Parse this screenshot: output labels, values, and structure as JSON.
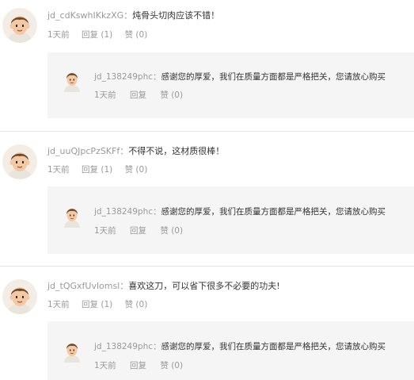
{
  "comments": [
    {
      "username": "jd_cdKswhIKkzXG",
      "separator": "：",
      "content": "炖骨头切肉应该不错！",
      "time": "1天前",
      "reply_label": "回复 (1)",
      "like_label": "赞 (0)",
      "reply": {
        "username": "jd_138249phc",
        "separator": "：",
        "content": "感谢您的厚爱，我们在质量方面都是严格把关，您请放心购买",
        "time": "1天前",
        "reply_label": "回复",
        "like_label": "赞 (0)"
      }
    },
    {
      "username": "jd_uuQJpcPzSKFf",
      "separator": "：",
      "content": "不得不说，这材质很棒！",
      "time": "1天前",
      "reply_label": "回复 (1)",
      "like_label": "赞 (0)",
      "reply": {
        "username": "jd_138249phc",
        "separator": "：",
        "content": "感谢您的厚爱，我们在质量方面都是严格把关，您请放心购买",
        "time": "1天前",
        "reply_label": "回复",
        "like_label": "赞 (0)"
      }
    },
    {
      "username": "jd_tQGxfUvlomsl",
      "separator": "：",
      "content": "喜欢这刀，可以省下很多不必要的功夫!",
      "time": "1天前",
      "reply_label": "回复 (1)",
      "like_label": "赞 (0)",
      "reply": {
        "username": "jd_138249phc",
        "separator": "：",
        "content": "感谢您的厚爱，我们在质量方面都是严格把关，您请放心购买",
        "time": "1天前",
        "reply_label": "回复",
        "like_label": "赞 (0)"
      }
    }
  ],
  "colors": {
    "muted_text": "#999999",
    "body_text": "#333333",
    "reply_background": "#f5f5f5",
    "divider": "#e5e5e5",
    "avatar_hair": "#6b4a2b",
    "avatar_skin": "#f3c9a5"
  }
}
